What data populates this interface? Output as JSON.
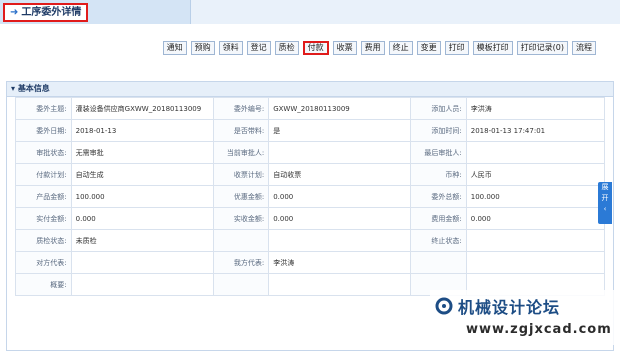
{
  "header": {
    "title": "工序委外详情"
  },
  "toolbar": {
    "buttons": [
      "通知",
      "预购",
      "领料",
      "登记",
      "质检",
      "付款",
      "收票",
      "费用",
      "终止",
      "变更",
      "打印",
      "模板打印",
      "打印记录(0)",
      "流程"
    ]
  },
  "section": {
    "title": "基本信息"
  },
  "rows": [
    {
      "l1": "委外主题:",
      "v1": "灌装设备供应商GXWW_20180113009",
      "l2": "委外编号:",
      "v2": "GXWW_20180113009",
      "l3": "添加人员:",
      "v3": "李洪涛"
    },
    {
      "l1": "委外日期:",
      "v1": "2018-01-13",
      "l2": "是否带料:",
      "v2": "是",
      "l3": "添加时间:",
      "v3": "2018-01-13 17:47:01"
    },
    {
      "l1": "审批状态:",
      "v1": "无需审批",
      "l2": "当前审批人:",
      "v2": "",
      "l3": "最后审批人:",
      "v3": ""
    },
    {
      "l1": "付款计划:",
      "v1": "自动生成",
      "l2": "收票计划:",
      "v2": "自动收票",
      "l3": "币种:",
      "v3": "人民币"
    },
    {
      "l1": "产品金额:",
      "v1": "100.000",
      "l2": "优惠金额:",
      "v2": "0.000",
      "l3": "委外总额:",
      "v3": "100.000"
    },
    {
      "l1": "实付金额:",
      "v1": "0.000",
      "l2": "实收金额:",
      "v2": "0.000",
      "l3": "费用金额:",
      "v3": "0.000"
    },
    {
      "l1": "质检状态:",
      "v1": "未质检",
      "l2": "",
      "v2": "",
      "l3": "终止状态:",
      "v3": ""
    },
    {
      "l1": "对方代表:",
      "v1": "",
      "l2": "我方代表:",
      "v2": "李洪涛",
      "l3": "",
      "v3": ""
    },
    {
      "l1": "概要:",
      "v1": "",
      "l2": "",
      "v2": "",
      "l3": "",
      "v3": ""
    }
  ],
  "side_tab": {
    "label1": "展",
    "label2": "开"
  },
  "watermark": {
    "title": "机械设计论坛",
    "url": "www.zgjxcad.com"
  }
}
